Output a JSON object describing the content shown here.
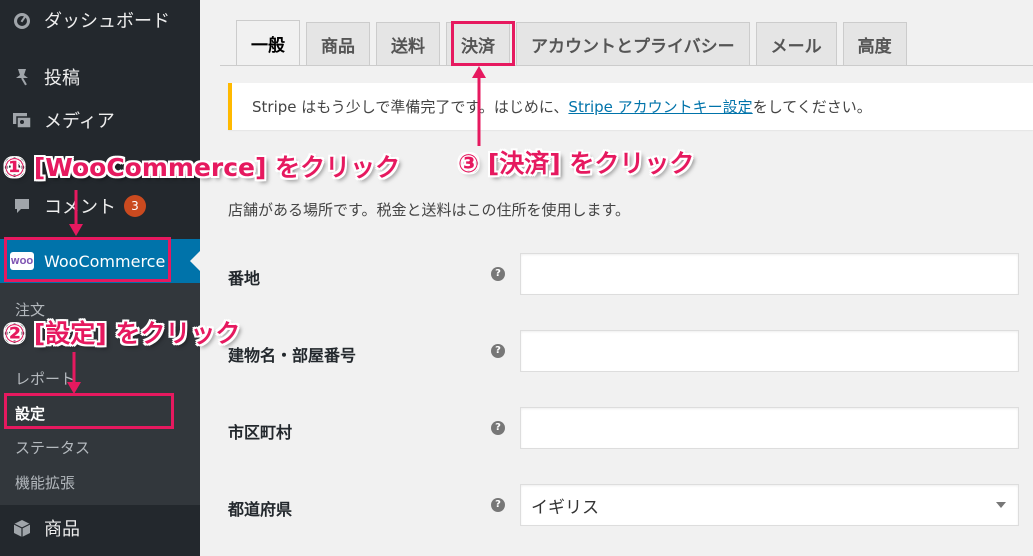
{
  "sidebar": {
    "dashboard": "ダッシュボード",
    "posts": "投稿",
    "media": "メディア",
    "comments": "コメント",
    "comments_count": "3",
    "woocommerce": "WooCommerce",
    "woo_logo": "WOO",
    "submenu": [
      "注文",
      "レポート",
      "設定",
      "ステータス",
      "機能拡張"
    ],
    "products": "商品"
  },
  "tabs": [
    "一般",
    "商品",
    "送料",
    "決済",
    "アカウントとプライバシー",
    "メール",
    "高度"
  ],
  "notice": {
    "before": "Stripe はもう少しで準備完了です。はじめに、",
    "link": "Stripe アカウントキー設定",
    "after": "をしてください。"
  },
  "section": {
    "desc": "店舗がある場所です。税金と送料はこの住所を使用します。"
  },
  "fields": [
    {
      "label": "番地",
      "value": ""
    },
    {
      "label": "建物名・部屋番号",
      "value": ""
    },
    {
      "label": "市区町村",
      "value": ""
    },
    {
      "label": "都道府県",
      "value": "イギリス"
    }
  ],
  "help_glyph": "?",
  "annotations": {
    "step1": "① [WooCommerce] をクリック",
    "step2": "② [設定] をクリック",
    "step3": "③ [決済] をクリック"
  },
  "colors": {
    "sidebar_bg": "#23282d",
    "submenu_bg": "#32373c",
    "active_menu": "#0073aa",
    "notice_border": "#ffb900",
    "annotation": "#e6195f",
    "badge": "#ca4a1f"
  }
}
